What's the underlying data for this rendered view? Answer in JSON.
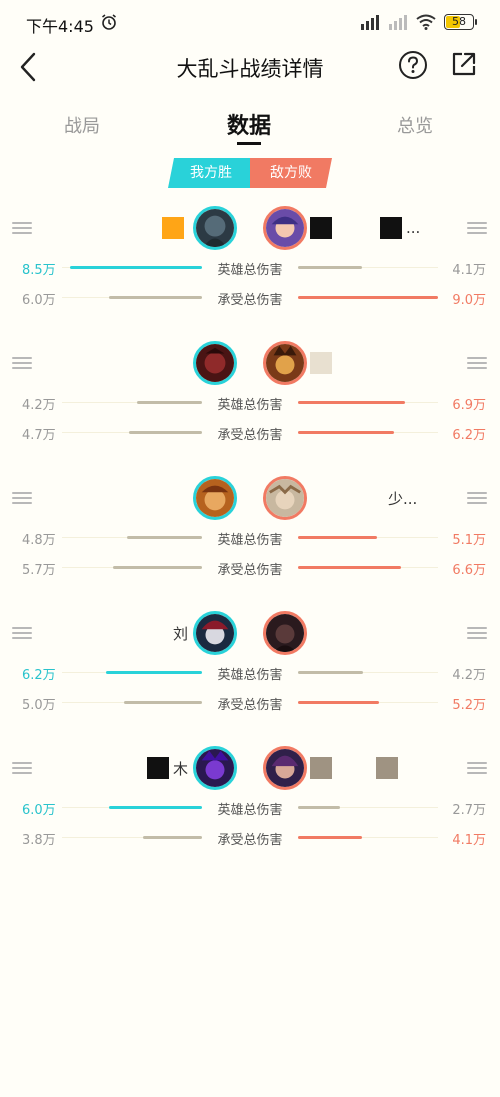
{
  "status": {
    "time": "下午4:45",
    "battery": "58",
    "battery_level": 0.58
  },
  "header": {
    "title": "大乱斗战绩详情"
  },
  "tabs": [
    {
      "label": "战局"
    },
    {
      "label": "数据"
    },
    {
      "label": "总览"
    }
  ],
  "result": {
    "ally": "我方胜",
    "enemy": "敌方败"
  },
  "stat_labels": {
    "hero_damage": "英雄总伤害",
    "damage_taken": "承受总伤害"
  },
  "matchups": [
    {
      "ally_name": "",
      "enemy_name": "...",
      "hero_damage": {
        "ally": "8.5万",
        "enemy": "4.1万",
        "ally_value": 8.5,
        "enemy_value": 4.1
      },
      "damage_taken": {
        "ally": "6.0万",
        "enemy": "9.0万",
        "ally_value": 6.0,
        "enemy_value": 9.0
      }
    },
    {
      "ally_name": "",
      "enemy_name": "",
      "hero_damage": {
        "ally": "4.2万",
        "enemy": "6.9万",
        "ally_value": 4.2,
        "enemy_value": 6.9
      },
      "damage_taken": {
        "ally": "4.7万",
        "enemy": "6.2万",
        "ally_value": 4.7,
        "enemy_value": 6.2
      }
    },
    {
      "ally_name": "",
      "enemy_name": "少...",
      "hero_damage": {
        "ally": "4.8万",
        "enemy": "5.1万",
        "ally_value": 4.8,
        "enemy_value": 5.1
      },
      "damage_taken": {
        "ally": "5.7万",
        "enemy": "6.6万",
        "ally_value": 5.7,
        "enemy_value": 6.6
      }
    },
    {
      "ally_name": "刘",
      "enemy_name": "",
      "hero_damage": {
        "ally": "6.2万",
        "enemy": "4.2万",
        "ally_value": 6.2,
        "enemy_value": 4.2
      },
      "damage_taken": {
        "ally": "5.0万",
        "enemy": "5.2万",
        "ally_value": 5.0,
        "enemy_value": 5.2
      }
    },
    {
      "ally_name": "木",
      "enemy_name": "",
      "hero_damage": {
        "ally": "6.0万",
        "enemy": "2.7万",
        "ally_value": 6.0,
        "enemy_value": 2.7
      },
      "damage_taken": {
        "ally": "3.8万",
        "enemy": "4.1万",
        "ally_value": 3.8,
        "enemy_value": 4.1
      }
    }
  ],
  "colors": {
    "ally": "#29d2d9",
    "enemy": "#f17a63",
    "neutral_bar": "#c2bca8"
  }
}
